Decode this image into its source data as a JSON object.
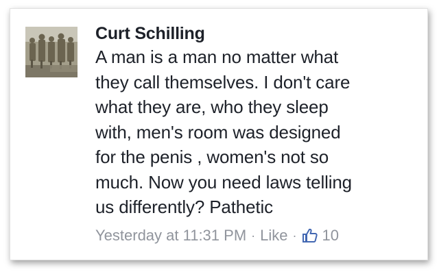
{
  "comment": {
    "author": "Curt Schilling",
    "text": "A man is a man no matter what\nthey call themselves. I don't care\nwhat they are, who they sleep\nwith, men's room was designed\nfor the penis , women's not so\nmuch. Now you need laws telling\nus differently? Pathetic",
    "timestamp": "Yesterday at 11:31 PM",
    "separator": "·",
    "like_label": "Like",
    "reaction_icon": "thumbs-up-icon",
    "like_count": "10"
  },
  "colors": {
    "text": "#1d2129",
    "meta": "#90949c",
    "like_blue": "#4267b2"
  }
}
